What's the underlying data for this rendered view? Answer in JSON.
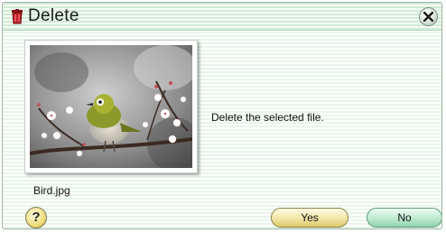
{
  "window": {
    "title": "Delete",
    "title_icon": "trash-can-icon",
    "close_icon": "close-icon"
  },
  "content": {
    "message": "Delete the selected file.",
    "filename": "Bird.jpg",
    "thumbnail": "bird-photo-thumbnail"
  },
  "buttons": {
    "help_label": "?",
    "yes_label": "Yes",
    "no_label": "No"
  },
  "colors": {
    "yes_button": "#f2e6a6",
    "no_button": "#bdebcf",
    "background_stripe": "#e7f6e8",
    "title_icon": "#c0202a"
  }
}
